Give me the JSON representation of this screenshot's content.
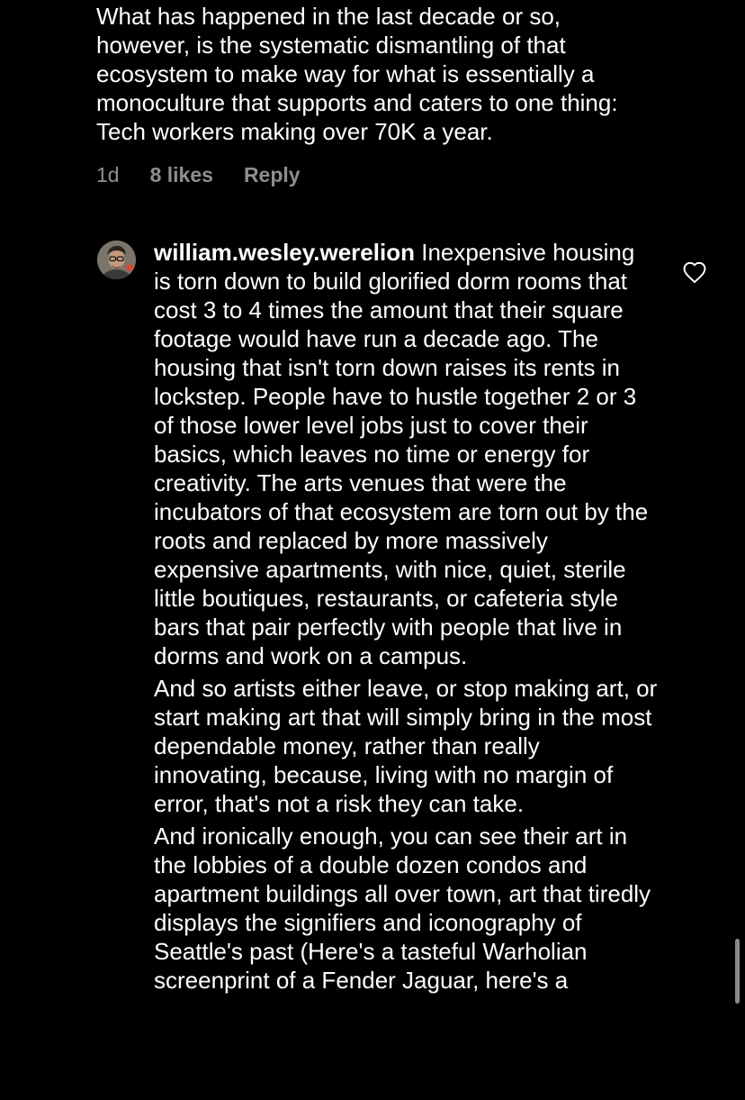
{
  "previous_comment": {
    "text": "What has happened in the last decade or so, however, is the systematic dismantling of that ecosystem to make way for what is essentially a monoculture that supports and caters to one thing: Tech workers making over 70K a year.",
    "time": "1d",
    "likes": "8 likes",
    "reply_label": "Reply"
  },
  "comment": {
    "username": "william.wesley.werelion",
    "paragraphs": [
      "Inexpensive housing is torn down to build glorified dorm rooms that cost 3 to 4 times the amount that their square footage would have run a decade ago. The housing that isn't torn down raises its rents in lockstep. People have to hustle together 2 or 3 of those lower level jobs just to cover their basics, which leaves no time or energy for creativity. The arts venues that were the incubators of that ecosystem are torn out by the roots and replaced by more massively expensive apartments, with nice, quiet, sterile little boutiques, restaurants, or cafeteria style bars that pair perfectly with people that live in dorms and work on a campus.",
      "And so artists either leave, or stop making art, or start making art that will simply bring in the most dependable money, rather than really innovating, because, living with no margin of error,  that's not a risk they can take.",
      "And ironically enough, you can see their art in the lobbies of a double dozen condos and apartment buildings all over town, art that tiredly displays the signifiers and iconography of Seattle's past (Here's a tasteful Warholian screenprint of a Fender Jaguar, here's a"
    ],
    "avatar_icon": "profile-photo",
    "like_icon": "heart-outline-icon"
  },
  "colors": {
    "background": "#000000",
    "text": "#ffffff",
    "meta": "#8e8e8e",
    "scrollbar": "#8a8a8a"
  }
}
